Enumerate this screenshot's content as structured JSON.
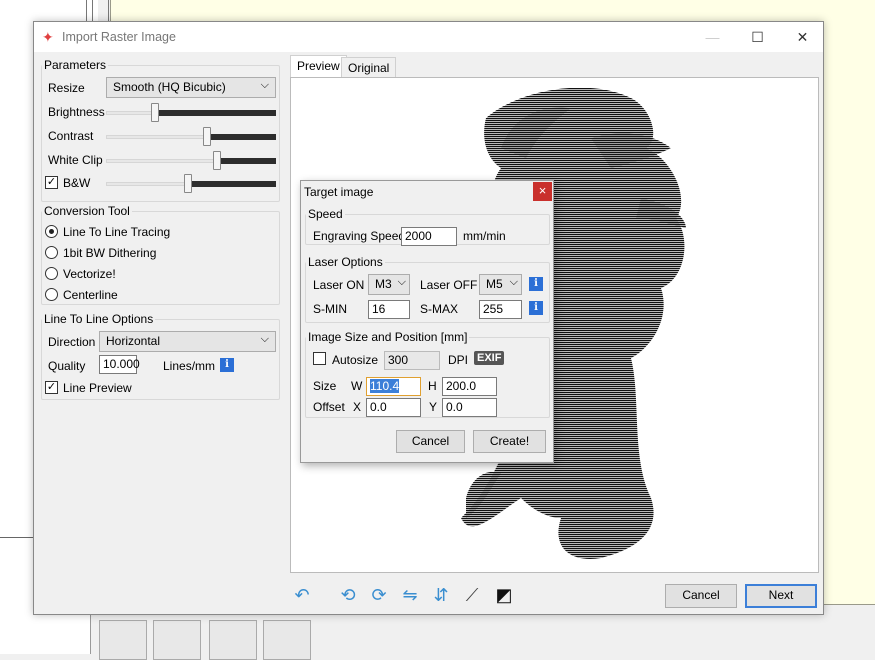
{
  "window": {
    "title": "Import Raster Image",
    "minimize": "—",
    "maximize": "☐",
    "close": "✕"
  },
  "parameters": {
    "legend": "Parameters",
    "resize_label": "Resize",
    "resize_value": "Smooth (HQ Bicubic)",
    "brightness_label": "Brightness",
    "brightness_level": 0.28,
    "contrast_label": "Contrast",
    "contrast_level": 0.6,
    "whiteclip_label": "White Clip",
    "whiteclip_level": 0.66,
    "bw_label": "B&W",
    "bw_checked": "✓",
    "bw_level": 0.48
  },
  "conversion": {
    "legend": "Conversion Tool",
    "options": [
      "Line To Line Tracing",
      "1bit BW Dithering",
      "Vectorize!",
      "Centerline"
    ],
    "selected": 0
  },
  "line_options": {
    "legend": "Line To Line Options",
    "direction_label": "Direction",
    "direction_value": "Horizontal",
    "quality_label": "Quality",
    "quality_value": "10.000",
    "quality_unit": "Lines/mm",
    "preview_label": "Line Preview",
    "preview_checked": "✓"
  },
  "tabs": [
    "Preview",
    "Original"
  ],
  "buttons": {
    "cancel": "Cancel",
    "next": "Next"
  },
  "dialog": {
    "title": "Target image",
    "close": "×",
    "speed_legend": "Speed",
    "engraving_speed_label": "Engraving Speed",
    "engraving_speed_value": "2000",
    "speed_unit": "mm/min",
    "laser_legend": "Laser Options",
    "laser_on_label": "Laser ON",
    "laser_on_value": "M3",
    "laser_off_label": "Laser OFF",
    "laser_off_value": "M5",
    "smin_label": "S-MIN",
    "smin_value": "16",
    "smax_label": "S-MAX",
    "smax_value": "255",
    "size_legend": "Image Size and Position [mm]",
    "autosize_label": "Autosize",
    "dpi_value": "300",
    "dpi_label": "DPI",
    "exif_label": "EXIF",
    "size_label": "Size",
    "w_label": "W",
    "w_value": "110.4",
    "h_label": "H",
    "h_value": "200.0",
    "offset_label": "Offset",
    "x_label": "X",
    "x_value": "0.0",
    "y_label": "Y",
    "y_value": "0.0",
    "cancel": "Cancel",
    "create": "Create!"
  },
  "info_icon": "i",
  "colors": {
    "accent": "#3c7fd8",
    "close_red": "#c9302c",
    "info_blue": "#2b6fd6"
  }
}
